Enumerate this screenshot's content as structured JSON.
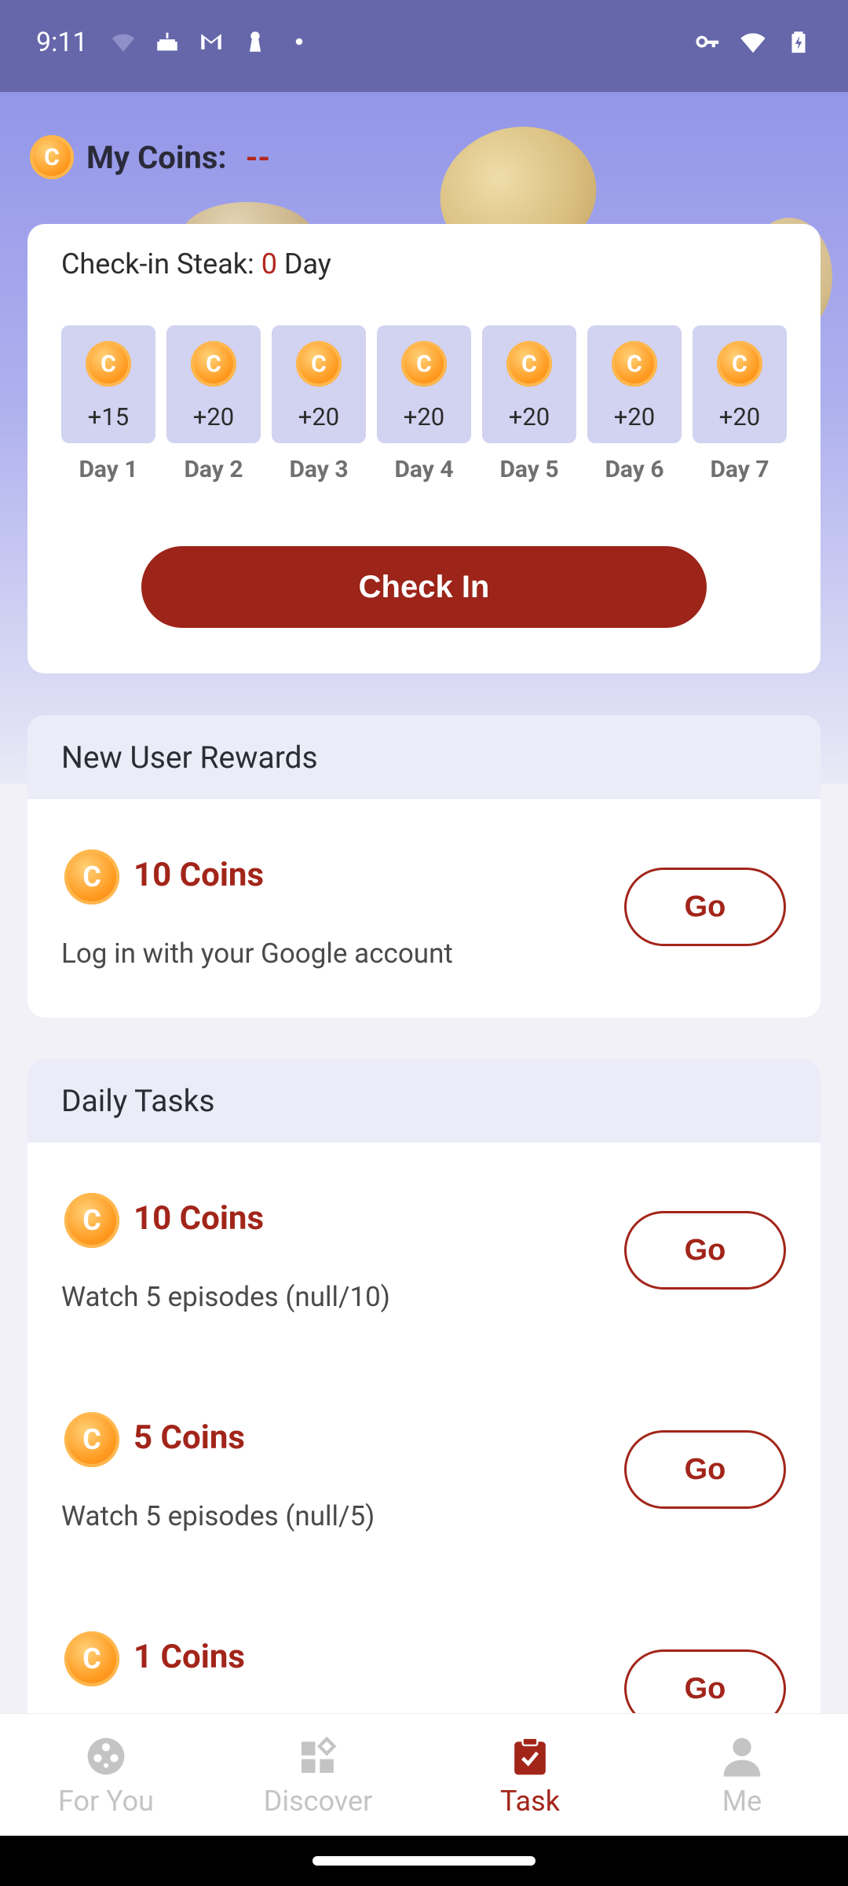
{
  "status_bar": {
    "time": "9:11"
  },
  "header": {
    "title": "My Coins:",
    "coins_value": "--"
  },
  "checkin": {
    "streak_prefix": "Check-in Steak:",
    "streak_count": "0",
    "streak_suffix": "Day",
    "days": [
      {
        "amount": "+15",
        "label": "Day 1"
      },
      {
        "amount": "+20",
        "label": "Day 2"
      },
      {
        "amount": "+20",
        "label": "Day 3"
      },
      {
        "amount": "+20",
        "label": "Day 4"
      },
      {
        "amount": "+20",
        "label": "Day 5"
      },
      {
        "amount": "+20",
        "label": "Day 6"
      },
      {
        "amount": "+20",
        "label": "Day 7"
      }
    ],
    "button_label": "Check In"
  },
  "new_user_rewards": {
    "title": "New User Rewards",
    "tasks": [
      {
        "reward": "10 Coins",
        "description": "Log in with your Google account",
        "button": "Go"
      }
    ]
  },
  "daily_tasks": {
    "title": "Daily Tasks",
    "tasks": [
      {
        "reward": "10 Coins",
        "description": "Watch 5 episodes (null/10)",
        "button": "Go"
      },
      {
        "reward": "5 Coins",
        "description": "Watch 5 episodes (null/5)",
        "button": "Go"
      },
      {
        "reward": "1 Coins",
        "description": "",
        "button": "Go"
      }
    ]
  },
  "coin_glyph": "C",
  "bottom_nav": [
    {
      "label": "For You",
      "icon": "film-reel-icon",
      "active": false
    },
    {
      "label": "Discover",
      "icon": "grid-icon",
      "active": false
    },
    {
      "label": "Task",
      "icon": "clipboard-check-icon",
      "active": true
    },
    {
      "label": "Me",
      "icon": "person-icon",
      "active": false
    }
  ],
  "colors": {
    "accent": "#a2251a",
    "status_bar": "#6567aa",
    "tile": "#d2d2f1",
    "inactive_nav": "#c4c4c4"
  }
}
